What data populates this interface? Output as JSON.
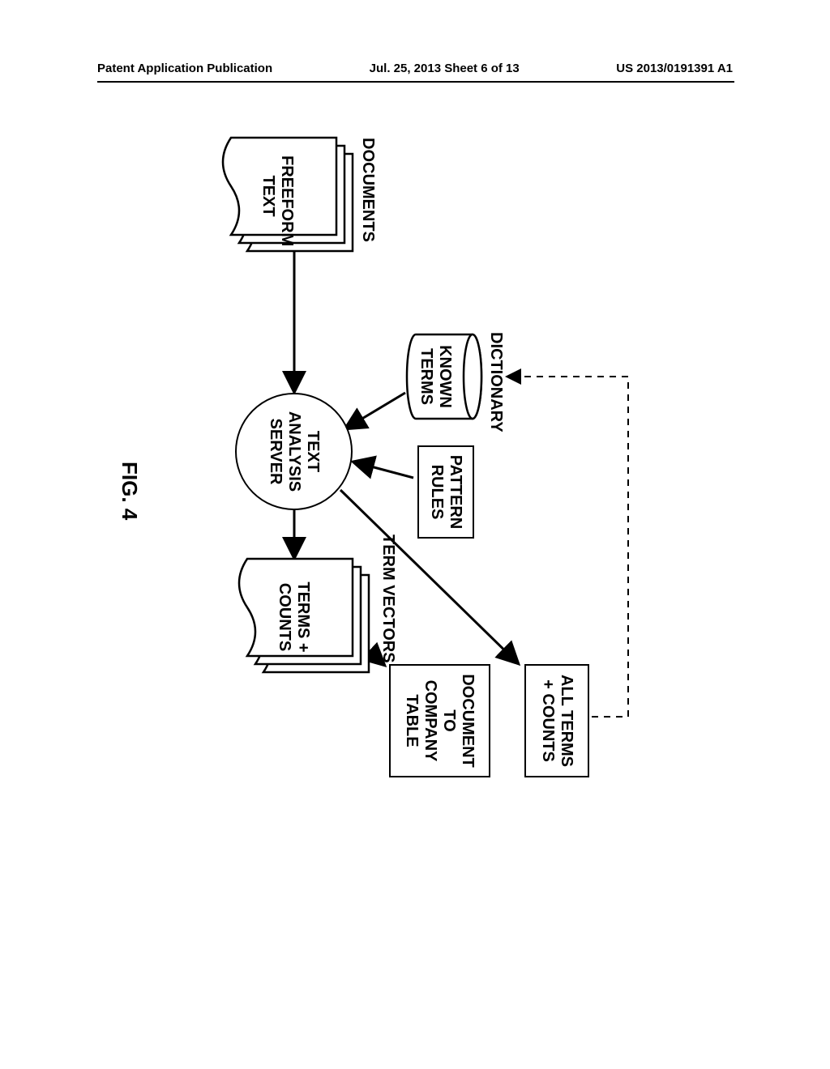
{
  "header": {
    "left": "Patent Application Publication",
    "center": "Jul. 25, 2013  Sheet 6 of 13",
    "right": "US 2013/0191391 A1"
  },
  "labels": {
    "documents": "DOCUMENTS",
    "dictionary": "DICTIONARY",
    "term_vectors": "TERM VECTORS",
    "figure": "FIG. 4"
  },
  "nodes": {
    "freeform_text": "FREEFORM\nTEXT",
    "known_terms": "KNOWN\nTERMS",
    "pattern_rules": "PATTERN\nRULES",
    "text_analysis_server": "TEXT\nANALYSIS\nSERVER",
    "terms_counts": "TERMS +\nCOUNTS",
    "all_terms_counts": "ALL TERMS\n+ COUNTS",
    "doc_to_company": "DOCUMENT\nTO\nCOMPANY\nTABLE"
  }
}
